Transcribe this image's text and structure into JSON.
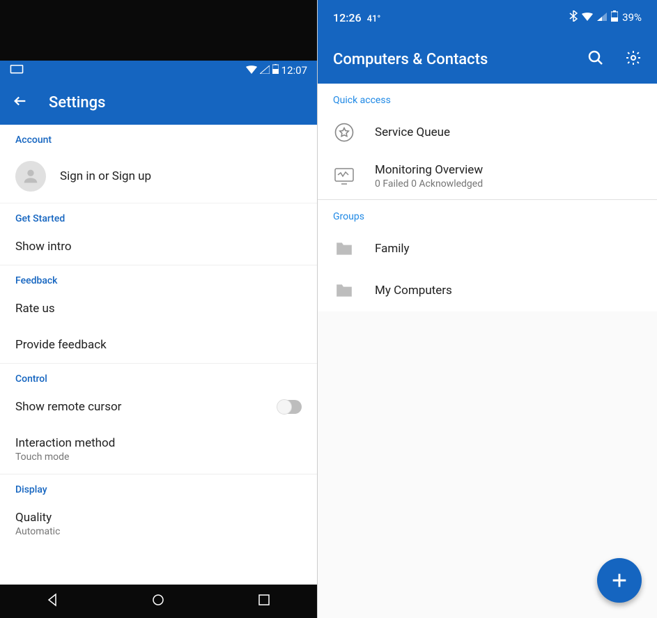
{
  "left": {
    "status": {
      "time": "12:07"
    },
    "appbar": {
      "title": "Settings"
    },
    "sections": {
      "account": {
        "header": "Account",
        "signin": "Sign in or Sign up"
      },
      "getstarted": {
        "header": "Get Started",
        "intro": "Show intro"
      },
      "feedback": {
        "header": "Feedback",
        "rate": "Rate us",
        "provide": "Provide feedback"
      },
      "control": {
        "header": "Control",
        "remotecursor": "Show remote cursor",
        "interaction": {
          "title": "Interaction method",
          "sub": "Touch mode"
        }
      },
      "display": {
        "header": "Display",
        "quality": {
          "title": "Quality",
          "sub": "Automatic"
        }
      }
    }
  },
  "right": {
    "status": {
      "time": "12:26",
      "temp": "41°",
      "battery": "39%"
    },
    "appbar": {
      "title": "Computers & Contacts"
    },
    "quickaccess": {
      "header": "Quick access",
      "service_queue": "Service Queue",
      "monitoring": {
        "title": "Monitoring Overview",
        "sub": "0 Failed 0 Acknowledged"
      }
    },
    "groups": {
      "header": "Groups",
      "family": "Family",
      "mycomputers": "My Computers"
    }
  }
}
